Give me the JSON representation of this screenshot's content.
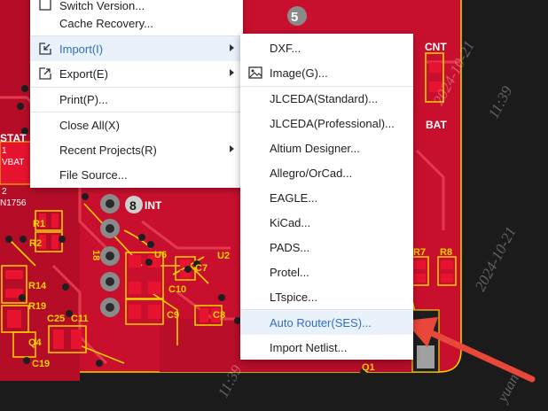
{
  "main_menu": {
    "items": [
      {
        "label": "Switch Version...",
        "has_submenu": false
      },
      {
        "label": "Cache Recovery...",
        "has_submenu": false
      },
      {
        "label": "Import(I)",
        "has_submenu": true
      },
      {
        "label": "Export(E)",
        "has_submenu": true
      },
      {
        "label": "Print(P)...",
        "has_submenu": false
      },
      {
        "label": "Close All(X)",
        "has_submenu": false
      },
      {
        "label": "Recent Projects(R)",
        "has_submenu": true
      },
      {
        "label": "File Source...",
        "has_submenu": false
      }
    ]
  },
  "import_submenu": {
    "items": [
      {
        "label": "DXF..."
      },
      {
        "label": "Image(G)..."
      },
      {
        "label": "JLCEDA(Standard)..."
      },
      {
        "label": "JLCEDA(Professional)..."
      },
      {
        "label": "Altium Designer..."
      },
      {
        "label": "Allegro/OrCad..."
      },
      {
        "label": "EAGLE..."
      },
      {
        "label": "KiCad..."
      },
      {
        "label": "PADS..."
      },
      {
        "label": "Protel..."
      },
      {
        "label": "LTspice..."
      },
      {
        "label": "Auto Router(SES)..."
      },
      {
        "label": "Import Netlist..."
      }
    ]
  },
  "pcb": {
    "pad_labels": [
      "5",
      "8"
    ],
    "net_labels": [
      "INT",
      "CNT",
      "BAT",
      "STAT"
    ],
    "designators": [
      "R1",
      "R2",
      "R14",
      "R19",
      "R7",
      "R8",
      "C25",
      "C11",
      "C7",
      "C10",
      "C9",
      "C8",
      "C19",
      "U6",
      "U2",
      "Q4",
      "Q1",
      "18"
    ],
    "header_text": [
      "1",
      "VBAT",
      "2",
      "N1756"
    ]
  },
  "watermarks": [
    "2024-10-21",
    "11:39",
    "2024-10-21",
    "11:39",
    "yuan"
  ],
  "colors": {
    "board_red": "#c8102e",
    "trace_red": "#e0263d",
    "silk_yellow": "#f5d300",
    "menu_accent": "#2f6fc1",
    "highlight_bg": "#e9f1fb",
    "arrow_red": "#e8473a"
  }
}
